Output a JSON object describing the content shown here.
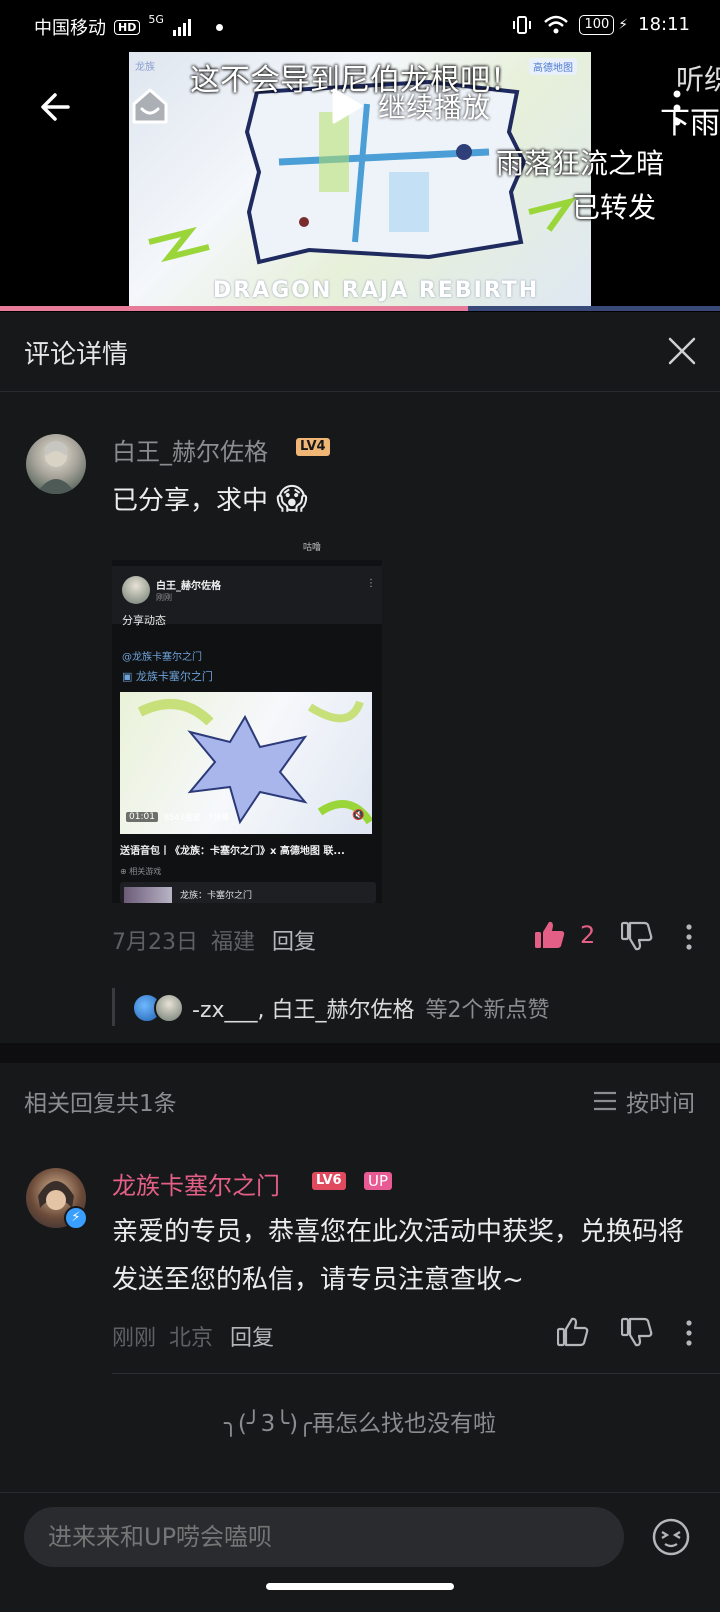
{
  "status_bar": {
    "carrier": "中国移动",
    "hd": "HD",
    "network": "5G",
    "battery": "100",
    "time": "18:11"
  },
  "video": {
    "title": "这不会导到尼伯龙根吧！",
    "play_label": "继续播放",
    "corner_channel": "龙族",
    "corner_brand": "高德地图",
    "watermark": "DRAGON RAJA REBIRTH",
    "side_caption_top": "听织",
    "side_caption_bottom": "下雨",
    "danmaku_1": "雨落狂流之暗",
    "danmaku_2": "已转发",
    "progress": 0.65
  },
  "panel": {
    "title": "评论详情"
  },
  "main_comment": {
    "username": "白王_赫尔佐格",
    "level": "LV4",
    "text": "已分享，求中",
    "emoji": "😱",
    "date": "7月23日",
    "location": "福建",
    "reply_label": "回复",
    "likes": "2",
    "liked_by_text": "-zx___, 白王_赫尔佐格",
    "liked_by_suffix": "等2个新点赞"
  },
  "shared_card": {
    "top_label": "咕噜",
    "username": "白王_赫尔佐格",
    "time": "刚刚",
    "action": "分享动态",
    "mention": "@龙族卡塞尔之门",
    "topic": "龙族卡塞尔之门",
    "duration": "01:01",
    "stats": "8543播放 · 7弹幕",
    "video_title": "送语音包丨《龙族：卡塞尔之门》x 高德地图 联...",
    "related_label": "相关游戏",
    "game_name": "龙族：卡塞尔之门"
  },
  "replies_header": {
    "count_label": "相关回复共1条",
    "sort_label": "按时间"
  },
  "reply": {
    "username": "龙族卡塞尔之门",
    "level": "LV6",
    "badge": "UP",
    "text": "亲爱的专员，恭喜您在此次活动中获奖，兑换码将发送至您的私信，请专员注意查收~",
    "time": "刚刚",
    "location": "北京",
    "reply_label": "回复"
  },
  "end_message": "╮(╯3╰)╭再怎么找也没有啦",
  "input": {
    "placeholder": "进来来和UP唠会嗑呗"
  },
  "colors": {
    "accent_pink": "#e35f86",
    "background": "#17181a",
    "level4": "#f0b676",
    "level6": "#e0495e"
  }
}
